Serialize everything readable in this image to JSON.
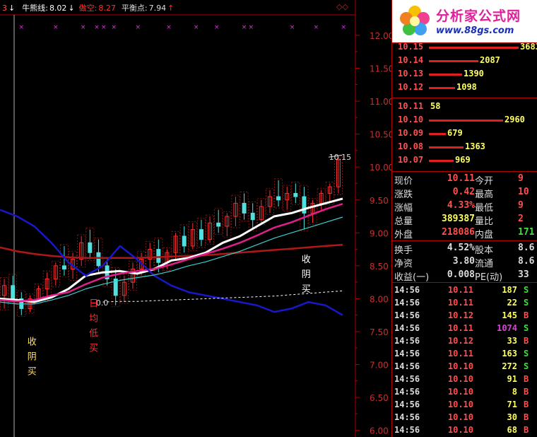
{
  "topbar": {
    "arrow_left": "↓",
    "indicator_name": "牛熊线:",
    "indicator_value": "8.02",
    "arrow_down": "↓",
    "short_label": "做空:",
    "short_value": "8.27",
    "balance_label": "平衡点:",
    "balance_value": "7.94",
    "arrow_up": "↑",
    "prefix_digit": "3",
    "diamonds": "◇◇"
  },
  "logo": {
    "title": "分析家公式网",
    "url": "www.88gs.com"
  },
  "ask_book": [
    {
      "price": "10.15",
      "volume": "3683",
      "frac": 0.99
    },
    {
      "price": "10.14",
      "volume": "2087",
      "frac": 0.55
    },
    {
      "price": "10.13",
      "volume": "1390",
      "frac": 0.37
    },
    {
      "price": "10.12",
      "volume": "1098",
      "frac": 0.29
    }
  ],
  "bid_book": [
    {
      "price": "10.11",
      "volume": "58",
      "frac": 0.0
    },
    {
      "price": "10.10",
      "volume": "2960",
      "frac": 0.82
    },
    {
      "price": "10.09",
      "volume": "679",
      "frac": 0.19
    },
    {
      "price": "10.08",
      "volume": "1363",
      "frac": 0.38
    },
    {
      "price": "10.07",
      "volume": "969",
      "frac": 0.27
    }
  ],
  "stats": [
    {
      "l1": "现价",
      "v1": "10.11",
      "c1": "#ff5050",
      "l2": "今开",
      "v2": "9",
      "c2": "#ff5050"
    },
    {
      "l1": "涨跌",
      "v1": "0.42",
      "c1": "#ff5050",
      "l2": "最高",
      "v2": "10",
      "c2": "#ff5050"
    },
    {
      "l1": "涨幅",
      "v1": "4.33%",
      "c1": "#ff5050",
      "l2": "最低",
      "v2": "9",
      "c2": "#ff5050"
    },
    {
      "l1": "总量",
      "v1": "389387",
      "c1": "#ffff60",
      "l2": "量比",
      "v2": "2",
      "c2": "#ff5050"
    },
    {
      "l1": "外盘",
      "v1": "218086",
      "c1": "#ff5050",
      "l2": "内盘",
      "v2": "171",
      "c2": "#40e040"
    }
  ],
  "stats2": [
    {
      "l1": "换手",
      "v1": "4.52%",
      "c1": "#dcdcdc",
      "l2": "股本",
      "v2": "8.6",
      "c2": "#dcdcdc"
    },
    {
      "l1": "净资",
      "v1": "3.80",
      "c1": "#dcdcdc",
      "l2": "流通",
      "v2": "8.6",
      "c2": "#dcdcdc"
    },
    {
      "l1": "收益(一)",
      "v1": "0.008",
      "c1": "#dcdcdc",
      "l2": "PE(动)",
      "v2": "33",
      "c2": "#dcdcdc"
    }
  ],
  "ticks": [
    {
      "time": "14:56",
      "price": "10.11",
      "vol": "187",
      "bs": "S",
      "vc": "#ffff60",
      "bc": "#40e040"
    },
    {
      "time": "14:56",
      "price": "10.11",
      "vol": "22",
      "bs": "S",
      "vc": "#ffff60",
      "bc": "#40e040"
    },
    {
      "time": "14:56",
      "price": "10.12",
      "vol": "145",
      "bs": "B",
      "vc": "#ffff60",
      "bc": "#ff5050"
    },
    {
      "time": "14:56",
      "price": "10.11",
      "vol": "1074",
      "bs": "S",
      "vc": "#e040e0",
      "bc": "#40e040"
    },
    {
      "time": "14:56",
      "price": "10.12",
      "vol": "33",
      "bs": "B",
      "vc": "#ffff60",
      "bc": "#ff5050"
    },
    {
      "time": "14:56",
      "price": "10.11",
      "vol": "163",
      "bs": "S",
      "vc": "#ffff60",
      "bc": "#40e040"
    },
    {
      "time": "14:56",
      "price": "10.10",
      "vol": "272",
      "bs": "S",
      "vc": "#ffff60",
      "bc": "#40e040"
    },
    {
      "time": "14:56",
      "price": "10.10",
      "vol": "91",
      "bs": "B",
      "vc": "#ffff60",
      "bc": "#ff5050"
    },
    {
      "time": "14:56",
      "price": "10.10",
      "vol": "8",
      "bs": "B",
      "vc": "#ffff60",
      "bc": "#ff5050"
    },
    {
      "time": "14:56",
      "price": "10.10",
      "vol": "71",
      "bs": "B",
      "vc": "#ffff60",
      "bc": "#ff5050"
    },
    {
      "time": "14:56",
      "price": "10.10",
      "vol": "30",
      "bs": "B",
      "vc": "#ffff60",
      "bc": "#ff5050"
    },
    {
      "time": "14:56",
      "price": "10.10",
      "vol": "68",
      "bs": "B",
      "vc": "#ffff60",
      "bc": "#ff5050"
    }
  ],
  "chart_data": {
    "type": "line",
    "title": "",
    "ylim": [
      5.9,
      12.3
    ],
    "y_ticks": [
      "12.00",
      "11.50",
      "11.00",
      "10.50",
      "10.00",
      "9.50",
      "9.00",
      "8.50",
      "8.00",
      "7.50",
      "7.00",
      "6.50",
      "6.00"
    ],
    "y_tick_values": [
      12.0,
      11.5,
      11.0,
      10.5,
      10.0,
      9.5,
      9.0,
      8.5,
      8.0,
      7.5,
      7.0,
      6.5,
      6.0
    ],
    "annotations": [
      {
        "text": "10.15",
        "x": 96,
        "y": 10.15,
        "color": "#dcdcdc"
      },
      {
        "text": "0.0",
        "x": 28,
        "y": 7.94,
        "color": "#dcdcdc"
      }
    ],
    "signal_labels": [
      {
        "chars": [
          "收",
          "阴",
          "买"
        ],
        "color": "#ffe060",
        "x": 8,
        "y_top": 7.3
      },
      {
        "chars": [
          "日",
          "均",
          "低",
          "买"
        ],
        "color": "#ff3030",
        "x": 26,
        "y_top": 7.88
      },
      {
        "chars": [
          "收",
          "阴",
          "买"
        ],
        "color": "#ffffff",
        "x": 88,
        "y_top": 8.55
      }
    ],
    "series": [
      {
        "name": "",
        "color": "#b01818",
        "values": [
          8.78,
          8.72,
          8.68,
          8.65,
          8.63,
          8.62,
          8.62,
          8.62,
          8.62,
          8.63,
          8.64,
          8.65,
          8.66,
          8.68,
          8.7,
          8.72,
          8.74,
          8.76,
          8.78,
          8.8,
          8.82
        ]
      },
      {
        "name": "",
        "color": "#ffffff",
        "values": [
          8.0,
          7.98,
          7.95,
          8.02,
          8.15,
          8.35,
          8.4,
          8.42,
          8.38,
          8.45,
          8.58,
          8.62,
          8.7,
          8.85,
          8.95,
          9.1,
          9.25,
          9.3,
          9.38,
          9.45,
          9.52
        ]
      },
      {
        "name": "",
        "color": "#e0208a",
        "values": [
          7.98,
          7.96,
          7.98,
          8.05,
          8.1,
          8.22,
          8.32,
          8.38,
          8.42,
          8.45,
          8.52,
          8.6,
          8.68,
          8.76,
          8.85,
          8.96,
          9.08,
          9.16,
          9.26,
          9.36,
          9.44
        ]
      },
      {
        "name": "",
        "color": "#1818c8",
        "values": [
          9.35,
          9.25,
          9.1,
          8.85,
          8.55,
          8.35,
          8.5,
          8.8,
          8.6,
          8.35,
          8.2,
          8.1,
          8.05,
          8.0,
          7.95,
          7.9,
          7.8,
          7.85,
          7.95,
          7.9,
          7.75
        ]
      },
      {
        "name": "",
        "color": "#3ad0d0",
        "values": [
          7.95,
          7.92,
          7.92,
          7.98,
          8.05,
          8.15,
          8.22,
          8.28,
          8.32,
          8.36,
          8.42,
          8.5,
          8.56,
          8.64,
          8.72,
          8.82,
          8.92,
          9.0,
          9.08,
          9.16,
          9.24
        ]
      },
      {
        "name": "",
        "color": "#ffffff",
        "dashed": true,
        "values": [
          null,
          null,
          null,
          null,
          null,
          null,
          7.95,
          7.96,
          7.96,
          7.97,
          7.98,
          7.99,
          8.0,
          8.01,
          8.02,
          8.03,
          8.04,
          8.06,
          8.08,
          8.1,
          8.12
        ]
      }
    ],
    "candles": [
      [
        8.05,
        8.3,
        7.85,
        8.2
      ],
      [
        8.2,
        8.35,
        7.95,
        8.0
      ],
      [
        8.0,
        8.1,
        7.75,
        7.85
      ],
      [
        7.85,
        8.05,
        7.8,
        8.0
      ],
      [
        8.0,
        8.2,
        7.95,
        8.15
      ],
      [
        8.15,
        8.4,
        8.0,
        8.3
      ],
      [
        8.3,
        8.55,
        8.2,
        8.5
      ],
      [
        8.5,
        8.8,
        8.35,
        8.45
      ],
      [
        8.45,
        8.7,
        8.3,
        8.6
      ],
      [
        8.6,
        8.95,
        8.5,
        8.85
      ],
      [
        8.85,
        9.05,
        8.6,
        8.7
      ],
      [
        8.7,
        8.9,
        8.4,
        8.5
      ],
      [
        8.5,
        8.6,
        8.2,
        8.3
      ],
      [
        8.3,
        8.45,
        7.9,
        8.05
      ],
      [
        8.05,
        8.35,
        7.95,
        8.25
      ],
      [
        8.25,
        8.55,
        8.15,
        8.45
      ],
      [
        8.45,
        8.7,
        8.35,
        8.6
      ],
      [
        8.6,
        8.85,
        8.45,
        8.75
      ],
      [
        8.75,
        8.9,
        8.4,
        8.55
      ],
      [
        8.55,
        8.75,
        8.45,
        8.7
      ],
      [
        8.7,
        9.0,
        8.6,
        8.95
      ],
      [
        8.95,
        9.1,
        8.7,
        8.8
      ],
      [
        8.8,
        9.15,
        8.75,
        9.05
      ],
      [
        9.05,
        9.2,
        8.8,
        8.9
      ],
      [
        8.9,
        9.25,
        8.85,
        9.15
      ],
      [
        9.15,
        9.35,
        9.0,
        9.1
      ],
      [
        9.1,
        9.3,
        8.95,
        9.25
      ],
      [
        9.25,
        9.55,
        9.1,
        9.45
      ],
      [
        9.45,
        9.6,
        9.2,
        9.3
      ],
      [
        9.3,
        9.45,
        9.05,
        9.2
      ],
      [
        9.2,
        9.5,
        9.15,
        9.4
      ],
      [
        9.4,
        9.65,
        9.3,
        9.55
      ],
      [
        9.55,
        9.8,
        9.4,
        9.5
      ],
      [
        9.5,
        9.7,
        9.35,
        9.6
      ],
      [
        9.6,
        9.75,
        9.45,
        9.55
      ],
      [
        9.55,
        9.7,
        9.05,
        9.3
      ],
      [
        9.3,
        9.5,
        9.15,
        9.45
      ],
      [
        9.45,
        9.65,
        9.35,
        9.6
      ],
      [
        9.6,
        9.75,
        9.45,
        9.7
      ],
      [
        9.7,
        10.15,
        9.6,
        10.11
      ]
    ],
    "markers_top": [
      3,
      13,
      21,
      25,
      27,
      30,
      37,
      46,
      54,
      60,
      68,
      70,
      82,
      89,
      97
    ]
  }
}
